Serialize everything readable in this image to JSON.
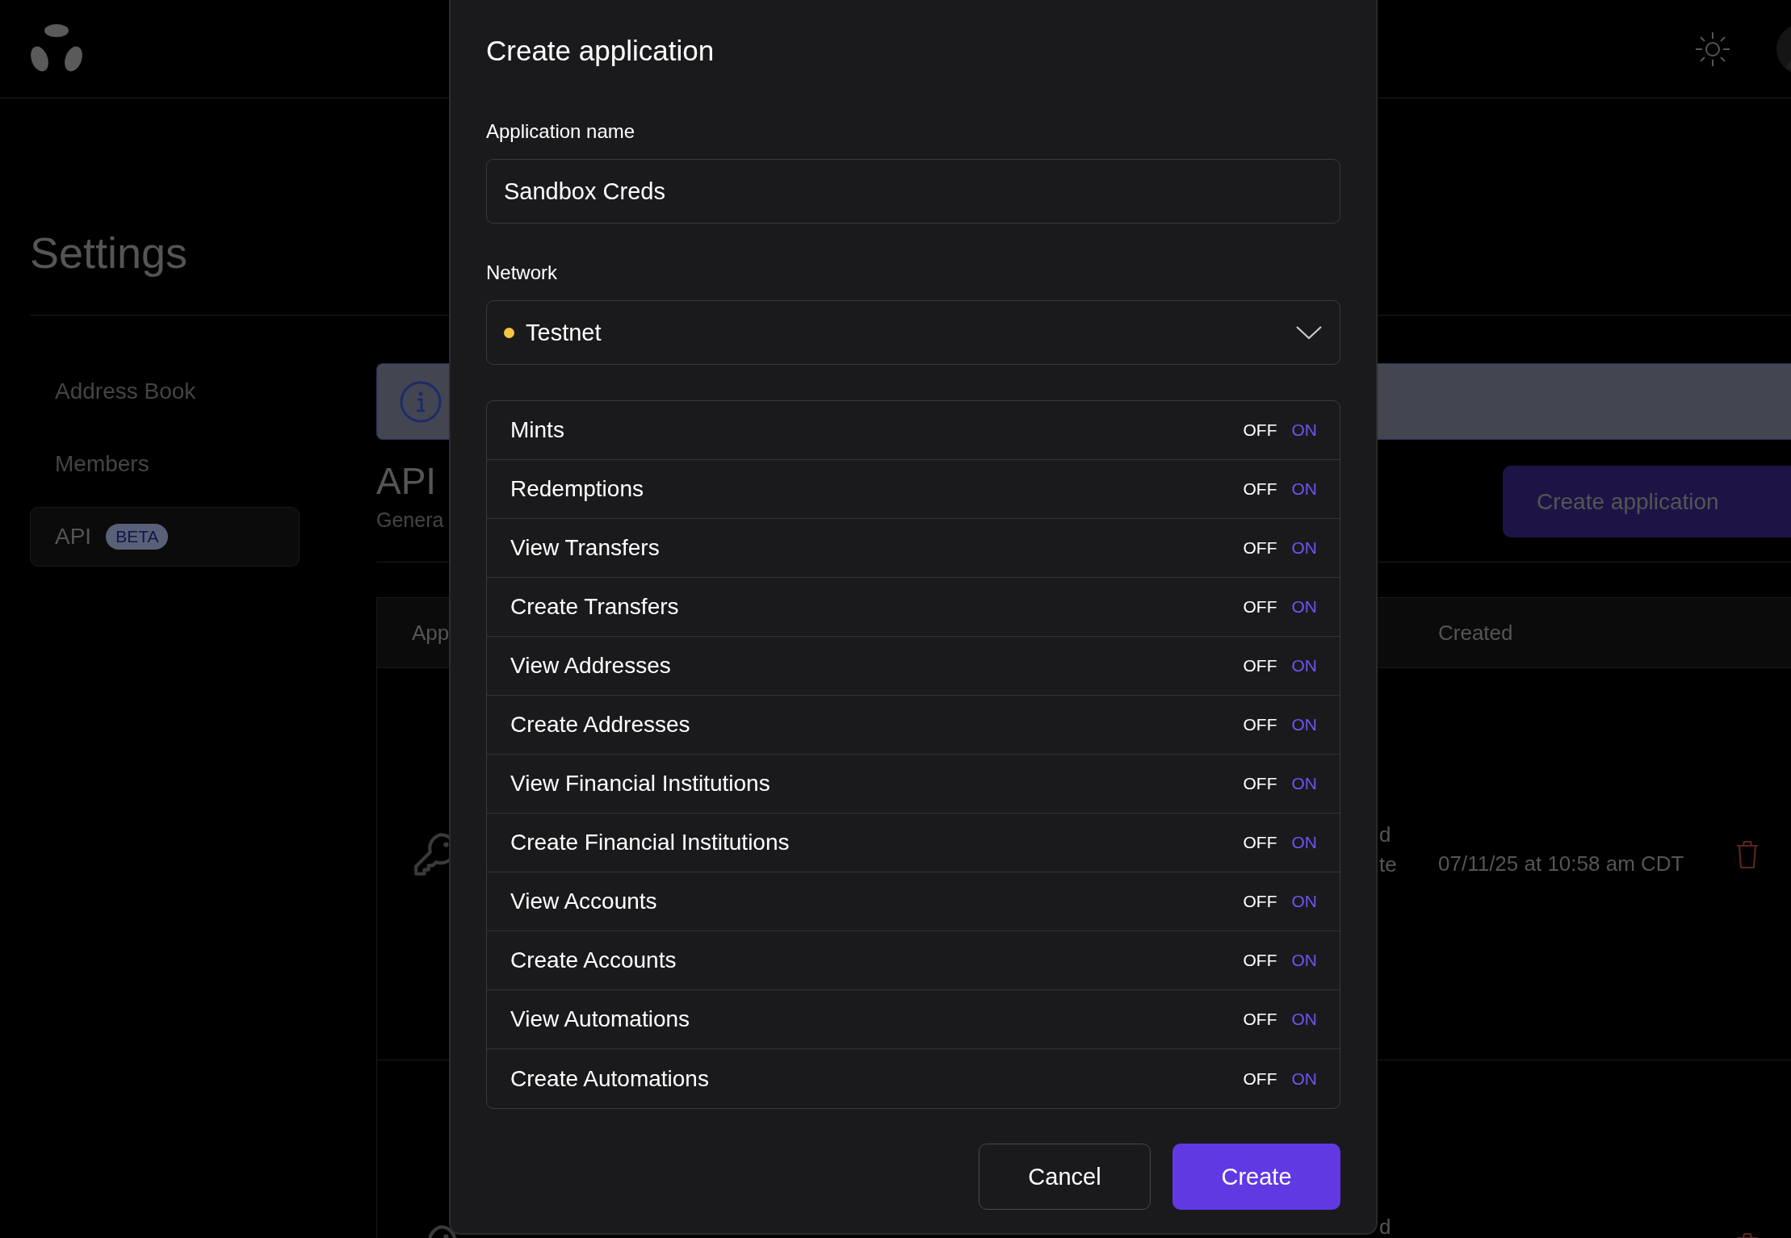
{
  "page": {
    "title": "Settings"
  },
  "sidebar": {
    "items": [
      {
        "label": "Address Book",
        "selected": false
      },
      {
        "label": "Members",
        "selected": false
      },
      {
        "label": "API",
        "badge": "BETA",
        "selected": true
      }
    ]
  },
  "content": {
    "heading": "API",
    "subtitle": "Genera",
    "create_button": "Create application",
    "table": {
      "columns": [
        "App",
        "Created"
      ],
      "rows": [
        {
          "column_2": [
            "d",
            "te"
          ],
          "created": "07/11/25 at 10:58 am CDT"
        },
        {
          "column_2": [
            "d"
          ]
        }
      ]
    }
  },
  "dialog": {
    "title": "Create application",
    "name_field": {
      "label": "Application name",
      "value": "Sandbox Creds"
    },
    "network": {
      "label": "Network",
      "value": "Testnet",
      "color": "#f5c542"
    },
    "permissions": [
      {
        "label": "Mints",
        "off": "OFF",
        "on_text": "ON",
        "on": true
      },
      {
        "label": "Redemptions",
        "off": "OFF",
        "on_text": "ON",
        "on": true
      },
      {
        "label": "View Transfers",
        "off": "OFF",
        "on_text": "ON",
        "on": true
      },
      {
        "label": "Create Transfers",
        "off": "OFF",
        "on_text": "ON",
        "on": true
      },
      {
        "label": "View Addresses",
        "off": "OFF",
        "on_text": "ON",
        "on": true
      },
      {
        "label": "Create Addresses",
        "off": "OFF",
        "on_text": "ON",
        "on": true
      },
      {
        "label": "View Financial Institutions",
        "off": "OFF",
        "on_text": "ON",
        "on": true
      },
      {
        "label": "Create Financial Institutions",
        "off": "OFF",
        "on_text": "ON",
        "on": true
      },
      {
        "label": "View Accounts",
        "off": "OFF",
        "on_text": "ON",
        "on": true
      },
      {
        "label": "Create Accounts",
        "off": "OFF",
        "on_text": "ON",
        "on": true
      },
      {
        "label": "View Automations",
        "off": "OFF",
        "on_text": "ON",
        "on": true
      },
      {
        "label": "Create Automations",
        "off": "OFF",
        "on_text": "ON",
        "on": true
      }
    ],
    "buttons": {
      "cancel": "Cancel",
      "create": "Create"
    }
  }
}
